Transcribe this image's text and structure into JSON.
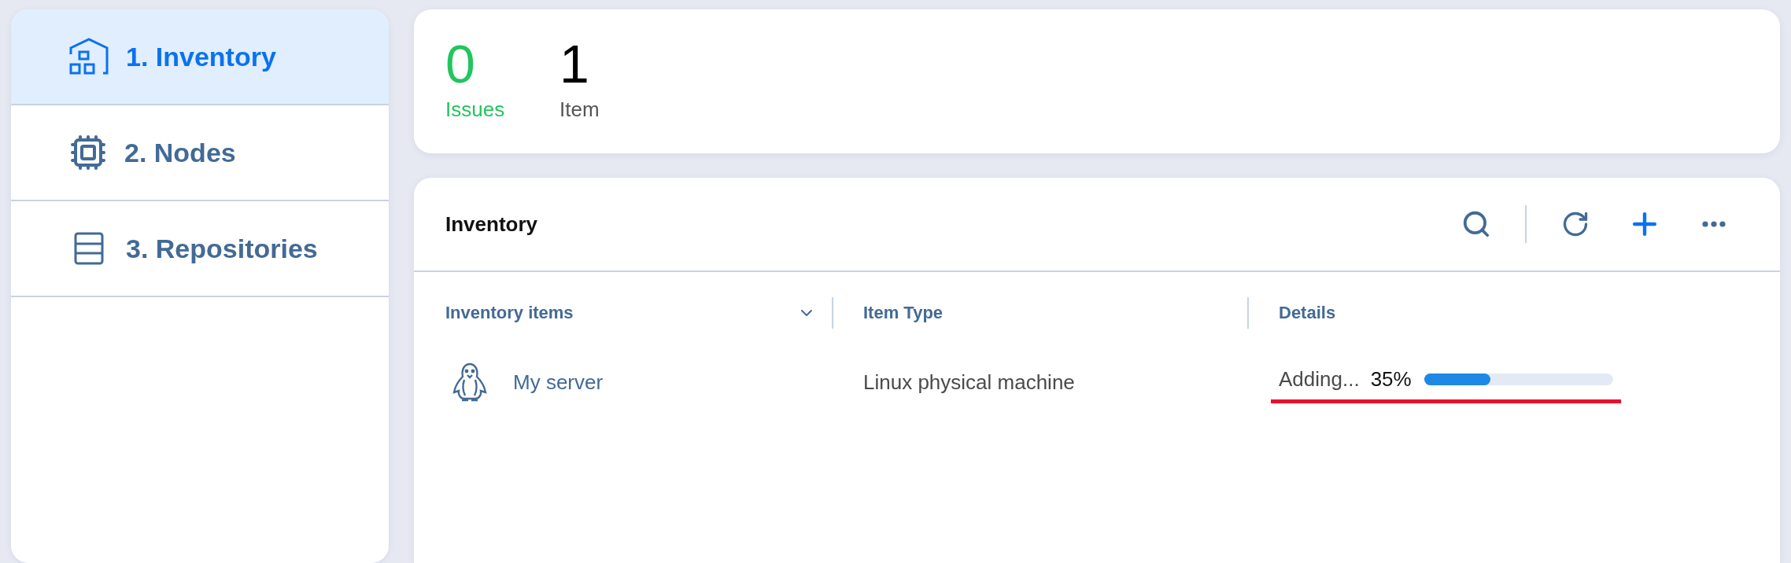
{
  "sidebar": {
    "items": [
      {
        "label": "1. Inventory",
        "selected": true
      },
      {
        "label": "2. Nodes",
        "selected": false
      },
      {
        "label": "3. Repositories",
        "selected": false
      }
    ]
  },
  "summary": [
    {
      "value": "0",
      "label": "Issues",
      "kind": "ok"
    },
    {
      "value": "1",
      "label": "Item",
      "kind": "neutral"
    }
  ],
  "panel": {
    "title": "Inventory",
    "columns": [
      {
        "label": "Inventory items",
        "sortable": true
      },
      {
        "label": "Item Type",
        "sortable": false
      },
      {
        "label": "Details",
        "sortable": false
      }
    ],
    "rows": [
      {
        "name": "My server",
        "type": "Linux physical machine",
        "status": "Adding...",
        "percent": "35%",
        "level": 0.35,
        "highlighted": true
      }
    ]
  }
}
